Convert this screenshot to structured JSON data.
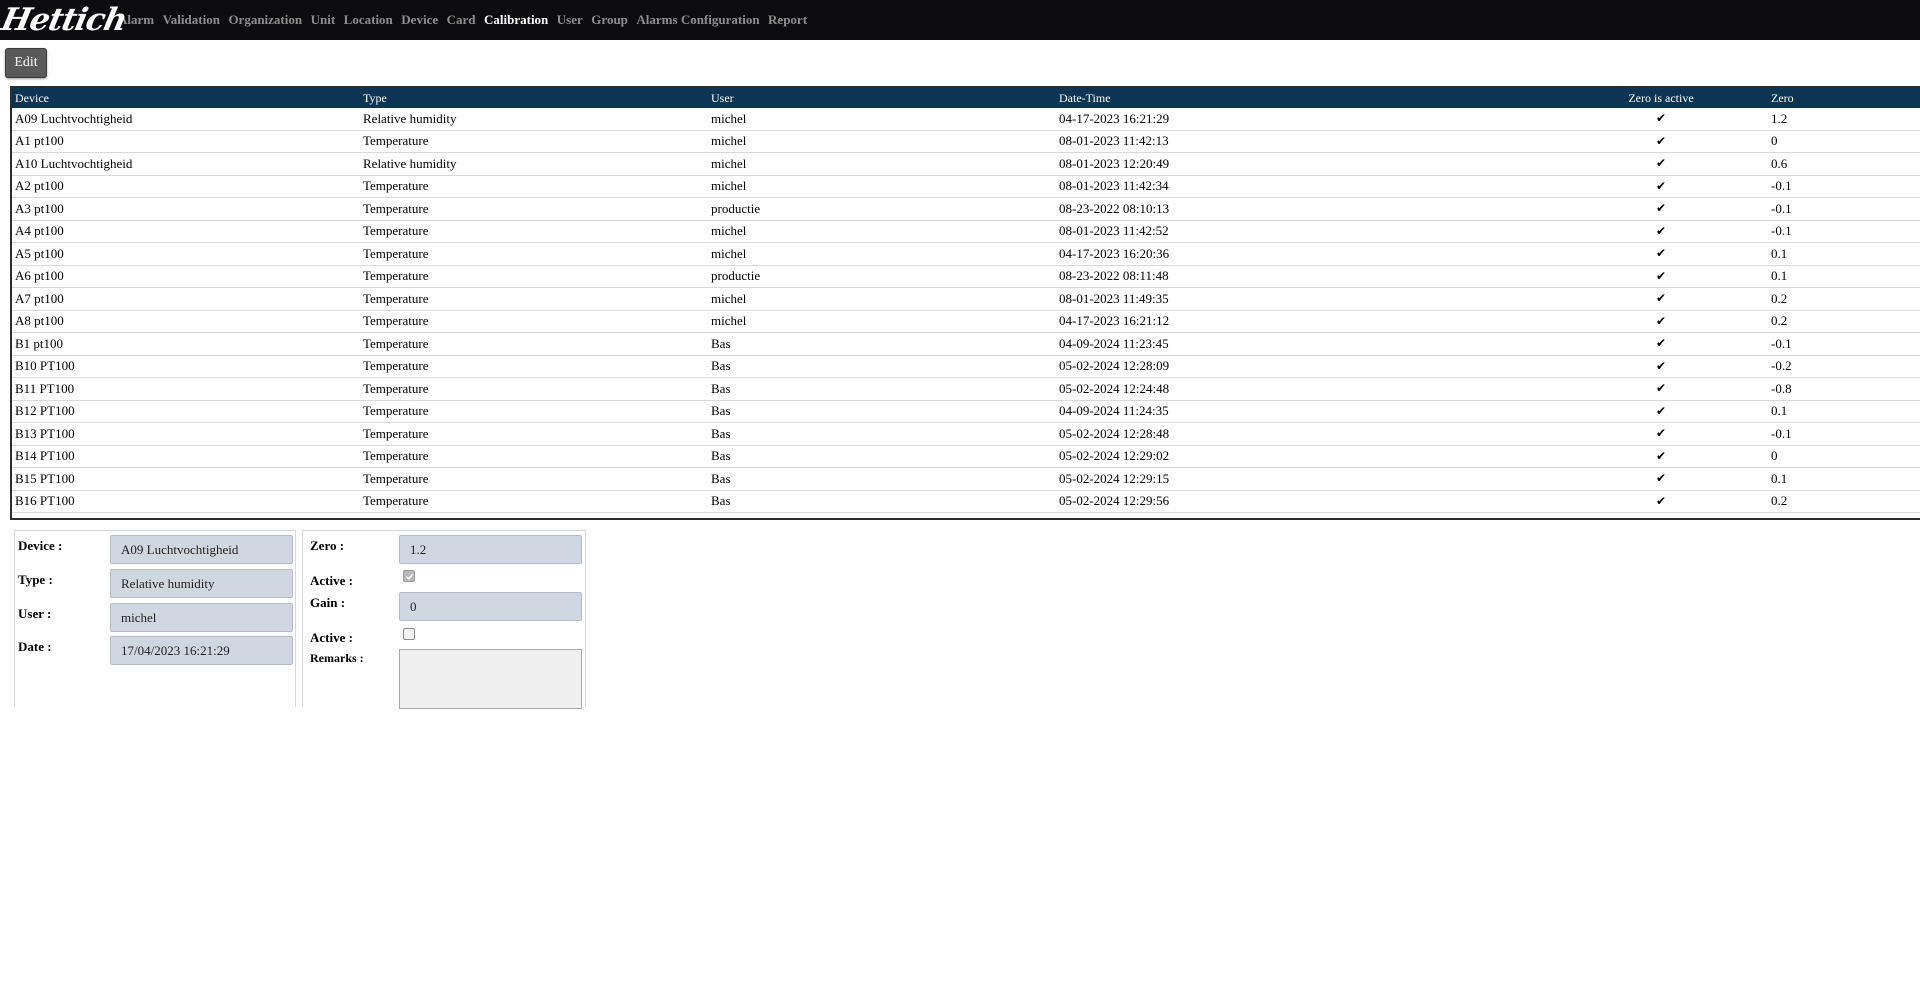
{
  "app": {
    "logo_text": "Hettich"
  },
  "nav": {
    "items": [
      {
        "label": "Alarm",
        "active": false
      },
      {
        "label": "Validation",
        "active": false
      },
      {
        "label": "Organization",
        "active": false
      },
      {
        "label": "Unit",
        "active": false
      },
      {
        "label": "Location",
        "active": false
      },
      {
        "label": "Device",
        "active": false
      },
      {
        "label": "Card",
        "active": false
      },
      {
        "label": "Calibration",
        "active": true
      },
      {
        "label": "User",
        "active": false
      },
      {
        "label": "Group",
        "active": false
      },
      {
        "label": "Alarms Configuration",
        "active": false
      },
      {
        "label": "Report",
        "active": false
      }
    ]
  },
  "toolbar": {
    "edit_label": "Edit"
  },
  "table": {
    "columns": [
      "Device",
      "Type",
      "User",
      "Date-Time",
      "Zero is active",
      "Zero"
    ],
    "check_glyph": "✔",
    "rows": [
      {
        "device": "A09 Luchtvochtigheid",
        "type": "Relative humidity",
        "user": "michel",
        "datetime": "04-17-2023 16:21:29",
        "zero_active": true,
        "zero": "1.2"
      },
      {
        "device": "A1 pt100",
        "type": "Temperature",
        "user": "michel",
        "datetime": "08-01-2023 11:42:13",
        "zero_active": true,
        "zero": "0"
      },
      {
        "device": "A10 Luchtvochtigheid",
        "type": "Relative humidity",
        "user": "michel",
        "datetime": "08-01-2023 12:20:49",
        "zero_active": true,
        "zero": "0.6"
      },
      {
        "device": "A2 pt100",
        "type": "Temperature",
        "user": "michel",
        "datetime": "08-01-2023 11:42:34",
        "zero_active": true,
        "zero": "-0.1"
      },
      {
        "device": "A3 pt100",
        "type": "Temperature",
        "user": "productie",
        "datetime": "08-23-2022 08:10:13",
        "zero_active": true,
        "zero": "-0.1"
      },
      {
        "device": "A4 pt100",
        "type": "Temperature",
        "user": "michel",
        "datetime": "08-01-2023 11:42:52",
        "zero_active": true,
        "zero": "-0.1"
      },
      {
        "device": "A5 pt100",
        "type": "Temperature",
        "user": "michel",
        "datetime": "04-17-2023 16:20:36",
        "zero_active": true,
        "zero": "0.1"
      },
      {
        "device": "A6 pt100",
        "type": "Temperature",
        "user": "productie",
        "datetime": "08-23-2022 08:11:48",
        "zero_active": true,
        "zero": "0.1"
      },
      {
        "device": "A7 pt100",
        "type": "Temperature",
        "user": "michel",
        "datetime": "08-01-2023 11:49:35",
        "zero_active": true,
        "zero": "0.2"
      },
      {
        "device": "A8 pt100",
        "type": "Temperature",
        "user": "michel",
        "datetime": "04-17-2023 16:21:12",
        "zero_active": true,
        "zero": "0.2"
      },
      {
        "device": "B1 pt100",
        "type": "Temperature",
        "user": "Bas",
        "datetime": "04-09-2024 11:23:45",
        "zero_active": true,
        "zero": "-0.1"
      },
      {
        "device": "B10 PT100",
        "type": "Temperature",
        "user": "Bas",
        "datetime": "05-02-2024 12:28:09",
        "zero_active": true,
        "zero": "-0.2"
      },
      {
        "device": "B11 PT100",
        "type": "Temperature",
        "user": "Bas",
        "datetime": "05-02-2024 12:24:48",
        "zero_active": true,
        "zero": "-0.8"
      },
      {
        "device": "B12 PT100",
        "type": "Temperature",
        "user": "Bas",
        "datetime": "04-09-2024 11:24:35",
        "zero_active": true,
        "zero": "0.1"
      },
      {
        "device": "B13 PT100",
        "type": "Temperature",
        "user": "Bas",
        "datetime": "05-02-2024 12:28:48",
        "zero_active": true,
        "zero": "-0.1"
      },
      {
        "device": "B14 PT100",
        "type": "Temperature",
        "user": "Bas",
        "datetime": "05-02-2024 12:29:02",
        "zero_active": true,
        "zero": "0"
      },
      {
        "device": "B15 PT100",
        "type": "Temperature",
        "user": "Bas",
        "datetime": "05-02-2024 12:29:15",
        "zero_active": true,
        "zero": "0.1"
      },
      {
        "device": "B16 PT100",
        "type": "Temperature",
        "user": "Bas",
        "datetime": "05-02-2024 12:29:56",
        "zero_active": true,
        "zero": "0.2"
      }
    ]
  },
  "detail": {
    "device_label": "Device :",
    "device_value": "A09 Luchtvochtigheid",
    "type_label": "Type :",
    "type_value": "Relative humidity",
    "user_label": "User :",
    "user_value": "michel",
    "date_label": "Date :",
    "date_value": "17/04/2023 16:21:29",
    "zero_label": "Zero :",
    "zero_value": "1.2",
    "zero_active_label": "Active :",
    "zero_active": true,
    "gain_label": "Gain :",
    "gain_value": "0",
    "gain_active_label": "Active :",
    "gain_active": false,
    "remarks_label": "Remarks :",
    "remarks_value": ""
  },
  "colors": {
    "topbar": "#0c0c0e",
    "header": "#0c3453",
    "field": "#d1d7e0"
  }
}
